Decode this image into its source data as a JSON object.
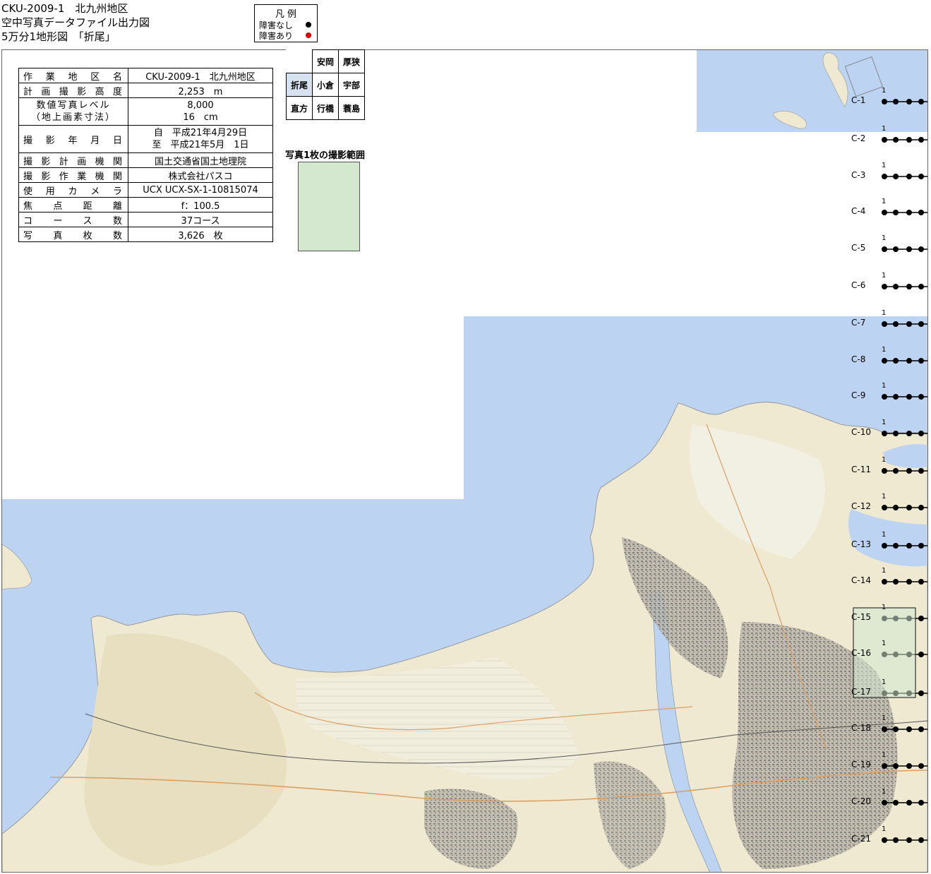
{
  "header": {
    "line1": "CKU-2009-1　北九州地区",
    "line2": "空中写真データファイル出力図",
    "line3": "5万分1地形図　「折尾」"
  },
  "legend": {
    "title": "凡 例",
    "no_obstacle": "障害なし",
    "obstacle": "障害あり",
    "no_obstacle_color": "#000000",
    "obstacle_color": "#dd0000"
  },
  "info_table": [
    {
      "key": "作業地区名",
      "value": "CKU-2009-1　北九州地区"
    },
    {
      "key": "計画撮影高度",
      "value": "2,253　m"
    },
    {
      "key": "数値写真レベル",
      "value": "8,000"
    },
    {
      "key": "（地上画素寸法）",
      "value": "16　cm"
    },
    {
      "key": "撮影年月日",
      "value": "自　平成21年4月29日"
    },
    {
      "key": "",
      "value": "至　平成21年5月　1日"
    },
    {
      "key": "撮影計画機関",
      "value": "国土交通省国土地理院"
    },
    {
      "key": "撮影作業機関",
      "value": "株式会社パスコ"
    },
    {
      "key": "使用カメラ",
      "value": "UCX UCX-SX-1-10815074"
    },
    {
      "key": "焦点距離",
      "value": "f：100.5"
    },
    {
      "key": "コース数",
      "value": "37コース"
    },
    {
      "key": "写真枚数",
      "value": "3,626　枚"
    }
  ],
  "index_map": [
    [
      "",
      "安岡",
      "厚狭"
    ],
    [
      "折尾",
      "小倉",
      "宇部"
    ],
    [
      "直方",
      "行橋",
      "蓑島"
    ]
  ],
  "range_title": "写真1枚の撮影範囲",
  "courses": [
    "C-1",
    "C-2",
    "C-3",
    "C-4",
    "C-5",
    "C-6",
    "C-7",
    "C-8",
    "C-9",
    "C-10",
    "C-11",
    "C-12",
    "C-13",
    "C-14",
    "C-15",
    "C-16",
    "C-17",
    "C-18",
    "C-19",
    "C-20",
    "C-21"
  ],
  "course_start_number": "1",
  "colors": {
    "sea": "#bcd3f2",
    "land": "#eee9d0",
    "land_light": "#f4f1e2",
    "urban": "#8c8c8c",
    "photo_range": "#d3e8cf"
  }
}
